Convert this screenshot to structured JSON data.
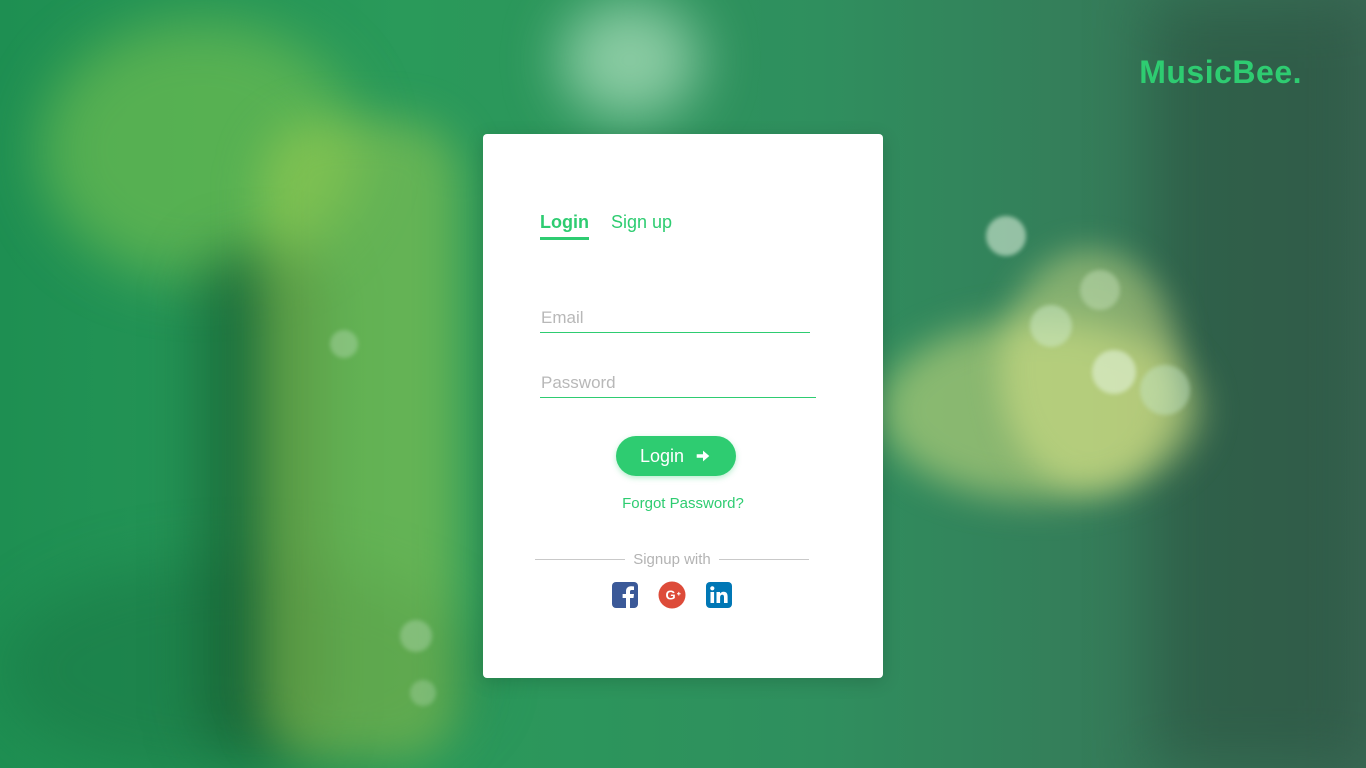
{
  "brand": {
    "name": "MusicBee."
  },
  "tabs": [
    {
      "label": "Login",
      "active": true
    },
    {
      "label": "Sign up",
      "active": false
    }
  ],
  "form": {
    "email": {
      "value": "",
      "placeholder": "Email"
    },
    "password": {
      "value": "",
      "placeholder": "Password"
    },
    "submit_label": "Login",
    "forgot_label": "Forgot Password?"
  },
  "social": {
    "divider_label": "Signup with",
    "providers": [
      {
        "name": "facebook",
        "icon": "facebook-icon",
        "color": "#3b5998"
      },
      {
        "name": "google-plus",
        "icon": "google-plus-icon",
        "color": "#dd4b39"
      },
      {
        "name": "linkedin",
        "icon": "linkedin-icon",
        "color": "#0077b5"
      }
    ]
  },
  "colors": {
    "accent": "#2ecc71",
    "card": "#ffffff",
    "muted": "#b3b3b3"
  }
}
